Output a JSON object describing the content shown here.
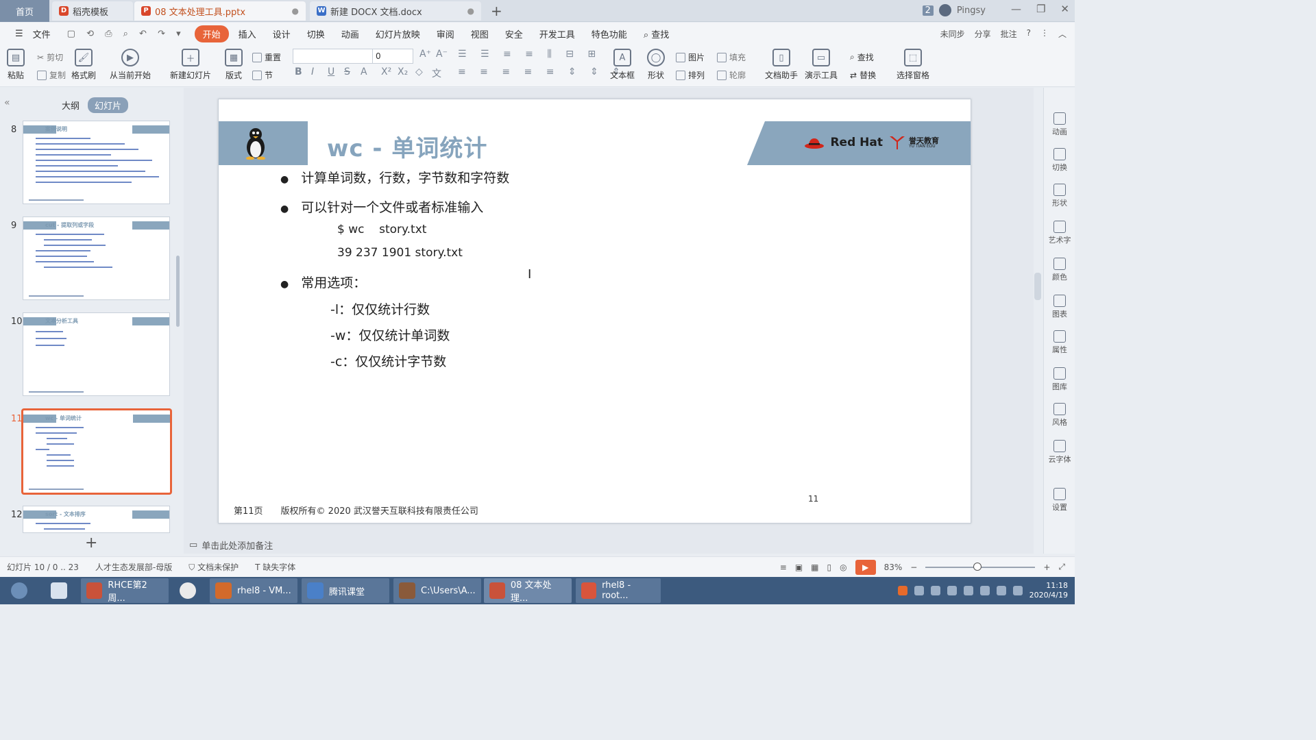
{
  "tabs": {
    "home": "首页",
    "template": "稻壳模板",
    "active_doc": "08 文本处理工具.pptx",
    "other_doc": "新建 DOCX 文档.docx",
    "badge": "2",
    "user": "Pingsy"
  },
  "menu": {
    "file": "文件",
    "items": [
      "开始",
      "插入",
      "设计",
      "切换",
      "动画",
      "幻灯片放映",
      "审阅",
      "视图",
      "安全",
      "开发工具",
      "特色功能"
    ],
    "search": "查找",
    "right": [
      "未同步",
      "分享",
      "批注"
    ]
  },
  "ribbon": {
    "paste": "粘贴",
    "cut": "剪切",
    "copy": "复制",
    "format_painter": "格式刷",
    "from_current": "从当前开始",
    "new_slide": "新建幻灯片",
    "layout": "版式",
    "reset": "重置",
    "section": "节",
    "font_size": "0",
    "textbox": "文本框",
    "shape": "形状",
    "picture": "图片",
    "fill": "填充",
    "arrange": "排列",
    "outline": "轮廓",
    "doc_helper": "文档助手",
    "present_tool": "演示工具",
    "find": "查找",
    "replace": "替换",
    "select_pane": "选择窗格"
  },
  "left_panel": {
    "outline_tab": "大纲",
    "slides_tab": "幻灯片",
    "thumbnails": [
      {
        "num": "8",
        "title": "案例说明"
      },
      {
        "num": "9",
        "title": "cut - 提取列或字段"
      },
      {
        "num": "10",
        "title": "文本分析工具"
      },
      {
        "num": "11",
        "title": "wc - 单词统计"
      },
      {
        "num": "12",
        "title": "sort - 文本排序"
      }
    ]
  },
  "slide": {
    "title": "wc - 单词统计",
    "brand_redhat": "Red Hat",
    "brand_yt_cn": "誉天教育",
    "brand_yt_en": "YU TIAN EDU",
    "bullet1": "计算单词数，行数，字节数和字符数",
    "bullet2": "可以针对一个文件或者标准输入",
    "code1": "$ wc    story.txt",
    "code2": "39 237 1901 story.txt",
    "bullet3": "常用选项：",
    "opt1": "-l：仅仅统计行数",
    "opt2": "-w：仅仅统计单词数",
    "opt3": "-c：仅仅统计字节数",
    "footer_page": "第11页",
    "footer_copyright": "版权所有© 2020 武汉誉天互联科技有限责任公司",
    "number": "11"
  },
  "right_panel": [
    "动画",
    "切换",
    "形状",
    "艺术字",
    "颜色",
    "图表",
    "属性",
    "图库",
    "风格",
    "云字体",
    "设置"
  ],
  "notes_placeholder": "单击此处添加备注",
  "status": {
    "slide_info": "幻灯片 10 / 0 .. 23",
    "theme": "人才生态发展部-母版",
    "protect": "文档未保护",
    "missing_font": "缺失字体",
    "zoom": "83%"
  },
  "taskbar": {
    "items": [
      "RHCE第2周...",
      "rhel8 - VM...",
      "腾讯课堂",
      "C:\\Users\\A...",
      "08 文本处理...",
      "rhel8 - root..."
    ],
    "time": "11:18",
    "date": "2020/4/19"
  },
  "colors": {
    "accent": "#e8643a",
    "header_band": "#8aa6bd",
    "title_color": "#86a4bd",
    "taskbar": "#3c5a7e"
  }
}
